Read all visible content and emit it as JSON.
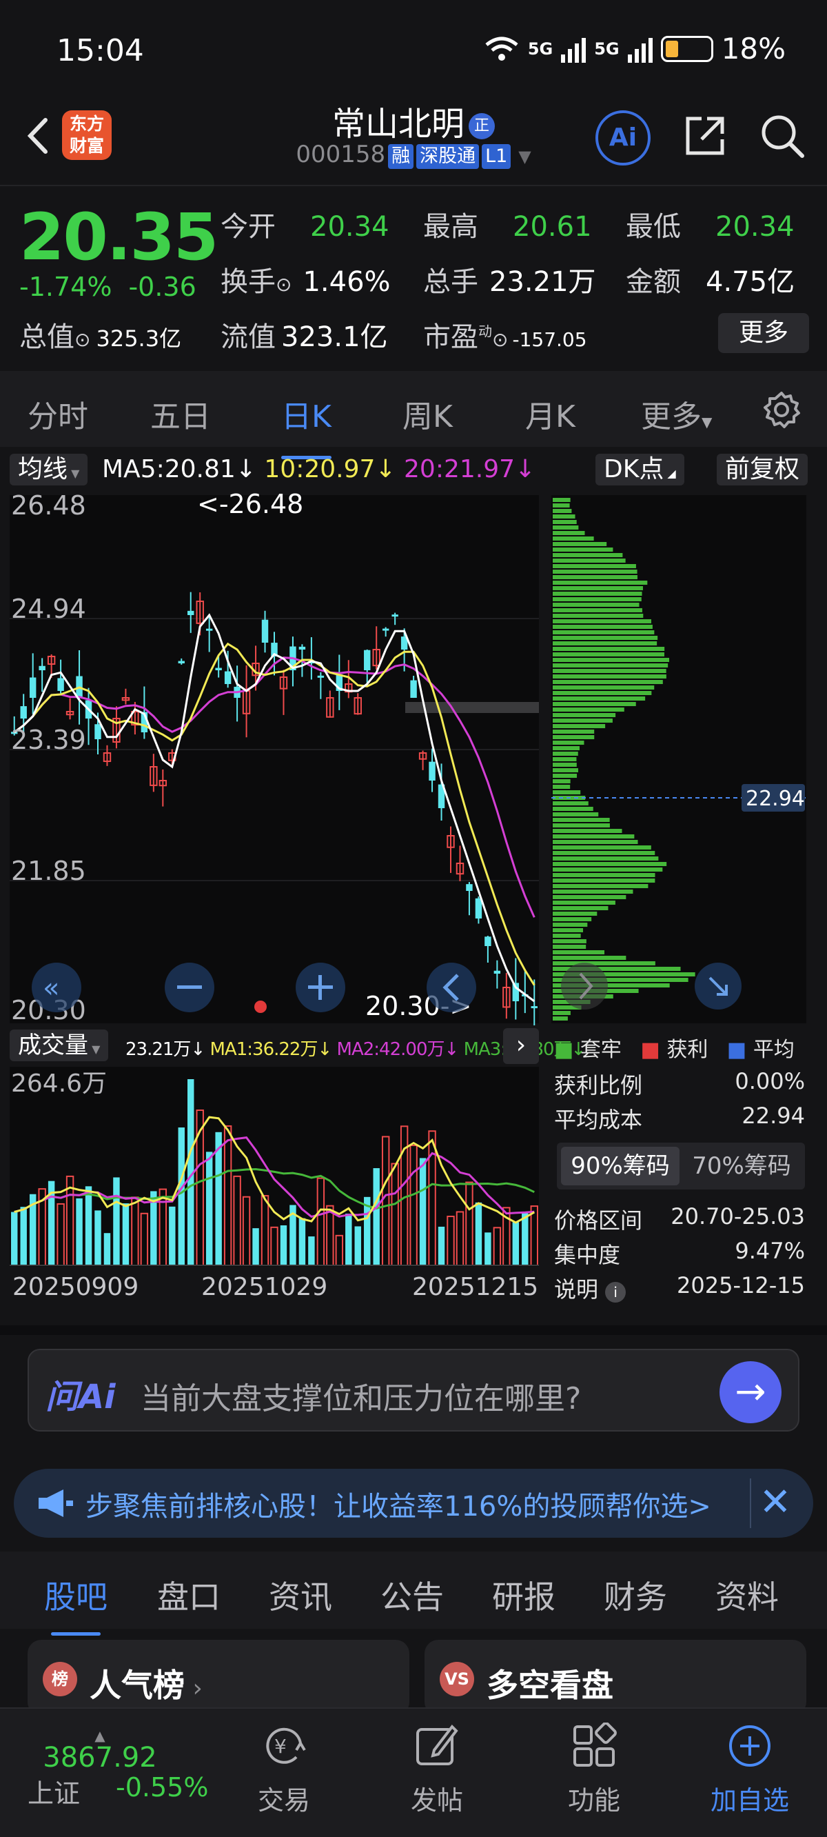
{
  "status_bar": {
    "time": "15:04",
    "battery": "18%",
    "network_1": "5G",
    "network_2": "5G"
  },
  "header": {
    "app_logo": "东方\n财富",
    "stock_name": "常山北明",
    "name_badge": "正",
    "stock_code": "000158",
    "tags": [
      "融",
      "深股通",
      "L1"
    ],
    "ai_label": "Ai"
  },
  "quote": {
    "price": "20.35",
    "change_pct": "-1.74%",
    "change_abs": "-0.36",
    "open_label": "今开",
    "open": "20.34",
    "high_label": "最高",
    "high": "20.61",
    "low_label": "最低",
    "low": "20.34",
    "turnover_label": "换手",
    "turnover": "1.46%",
    "volume_label": "总手",
    "volume": "23.21万",
    "amount_label": "金额",
    "amount": "4.75亿",
    "mktcap_label": "总值",
    "mktcap": "325.3亿",
    "float_label": "流值",
    "float_cap": "323.1亿",
    "pe_label": "市盈",
    "pe_super": "动",
    "pe": "-157.05",
    "more": "更多"
  },
  "chart_tabs": [
    "分时",
    "五日",
    "日K",
    "周K",
    "月K",
    "更多"
  ],
  "chart_tab_active": 2,
  "ma_bar": {
    "selector": "均线",
    "ma5": "MA5:20.81",
    "ma10": "10:20.97",
    "ma20": "20:21.97",
    "dk": "DK点",
    "adjust": "前复权"
  },
  "kline": {
    "y_labels": [
      "26.48",
      "24.94",
      "23.39",
      "21.85",
      "20.30"
    ],
    "max_note": "<-26.48",
    "min_note": "20.30->",
    "chip_price": "22.94"
  },
  "colors": {
    "up": "#ef4b4b",
    "down": "#5ee7ee",
    "ma5": "#ffffff",
    "ma10": "#f2ea55",
    "ma20": "#d43fd4",
    "chip": "#46b83a",
    "accent": "#4a8af5"
  },
  "volume": {
    "selector": "成交量",
    "current": "23.21万",
    "ma1": "MA1:36.22万",
    "ma2": "MA2:42.00万",
    "ma3": "MA3:73.80万",
    "max_label": "264.6万",
    "dates": [
      "20250909",
      "20251029",
      "20251215"
    ]
  },
  "chip_panel": {
    "legend": [
      "套牢",
      "获利",
      "平均"
    ],
    "profit_ratio_label": "获利比例",
    "profit_ratio": "0.00%",
    "avg_cost_label": "平均成本",
    "avg_cost": "22.94",
    "seg_90": "90%筹码",
    "seg_70": "70%筹码",
    "range_label": "价格区间",
    "range": "20.70-25.03",
    "concentration_label": "集中度",
    "concentration": "9.47%",
    "note_label": "说明",
    "note_date": "2025-12-15"
  },
  "ask_ai": {
    "label": "问Ai",
    "prompt": "当前大盘支撑位和压力位在哪里?"
  },
  "banner": {
    "text": "步聚焦前排核心股！让收益率116%的投顾帮你选>"
  },
  "sub_tabs": [
    "股吧",
    "盘口",
    "资讯",
    "公告",
    "研报",
    "财务",
    "资料"
  ],
  "cards": [
    {
      "icon": "榜",
      "title": "人气榜"
    },
    {
      "icon": "VS",
      "title": "多空看盘"
    }
  ],
  "bottom_nav": {
    "index_value": "3867.92",
    "index_name": "上证",
    "index_change": "-0.55%",
    "items": [
      "交易",
      "发帖",
      "功能",
      "加自选"
    ]
  }
}
